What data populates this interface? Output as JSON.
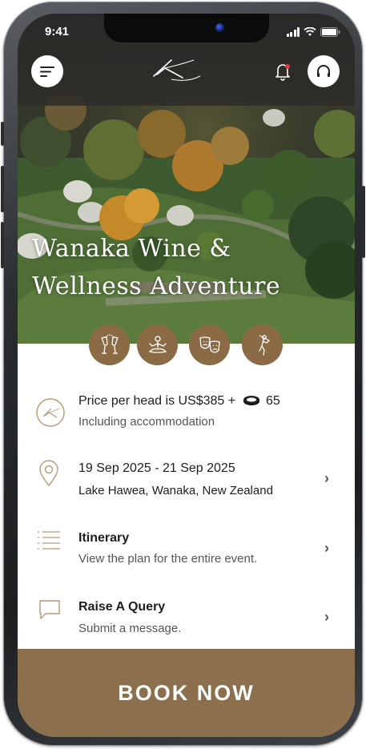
{
  "status_bar": {
    "time": "9:41"
  },
  "header": {
    "menu_icon": "menu-lines-icon",
    "logo_text": "K",
    "notification_icon": "bell-icon",
    "support_icon": "headphones-icon"
  },
  "hero": {
    "title_line1": "Wanaka Wine &",
    "title_line2": "Wellness Adventure"
  },
  "features": [
    {
      "icon": "champagne-glasses-icon"
    },
    {
      "icon": "meditation-icon"
    },
    {
      "icon": "theatre-masks-icon"
    },
    {
      "icon": "golf-icon"
    }
  ],
  "details": {
    "price": {
      "line1_prefix": "Price per head is US$385 +",
      "points": "65",
      "line2": "Including accommodation"
    },
    "event": {
      "dates": "19 Sep 2025  - 21 Sep 2025",
      "location": "Lake Hawea, Wanaka, New Zealand"
    },
    "itinerary": {
      "title": "Itinerary",
      "subtitle": "View the plan for the entire event."
    },
    "query": {
      "title": "Raise A Query",
      "subtitle": "Submit a message."
    }
  },
  "book_button": {
    "label": "BOOK NOW"
  },
  "colors": {
    "accent": "#8c6f4c",
    "icon_outline": "#b59a74"
  }
}
